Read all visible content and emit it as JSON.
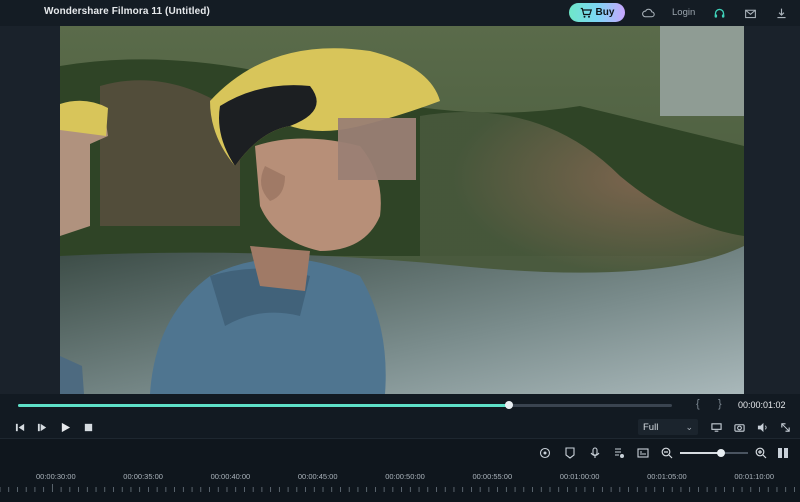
{
  "window": {
    "title": "Wondershare Filmora 11 (Untitled)"
  },
  "header": {
    "buy_label": "Buy",
    "login_label": "Login",
    "icons": [
      "cart-icon",
      "cloud-icon",
      "headset-icon",
      "mail-icon",
      "download-icon"
    ]
  },
  "player": {
    "progress": 0.75,
    "timecode": "00:00:01:02",
    "brace_open": "{",
    "brace_close": "}",
    "quality": "Full",
    "quality_chevron": "⌄"
  },
  "timeline": {
    "zoom_level": 0.6,
    "labels": [
      "00:00:30:00",
      "00:00:35:00",
      "00:00:40:00",
      "00:00:45:00",
      "00:00:50:00",
      "00:00:55:00",
      "00:01:00:00",
      "00:01:05:00",
      "00:01:10:00"
    ]
  },
  "colors": {
    "accent": "#5ee0c8",
    "buy_gradient_start": "#6ee7c8",
    "buy_gradient_end": "#c9a6ff",
    "background": "#121a22"
  }
}
